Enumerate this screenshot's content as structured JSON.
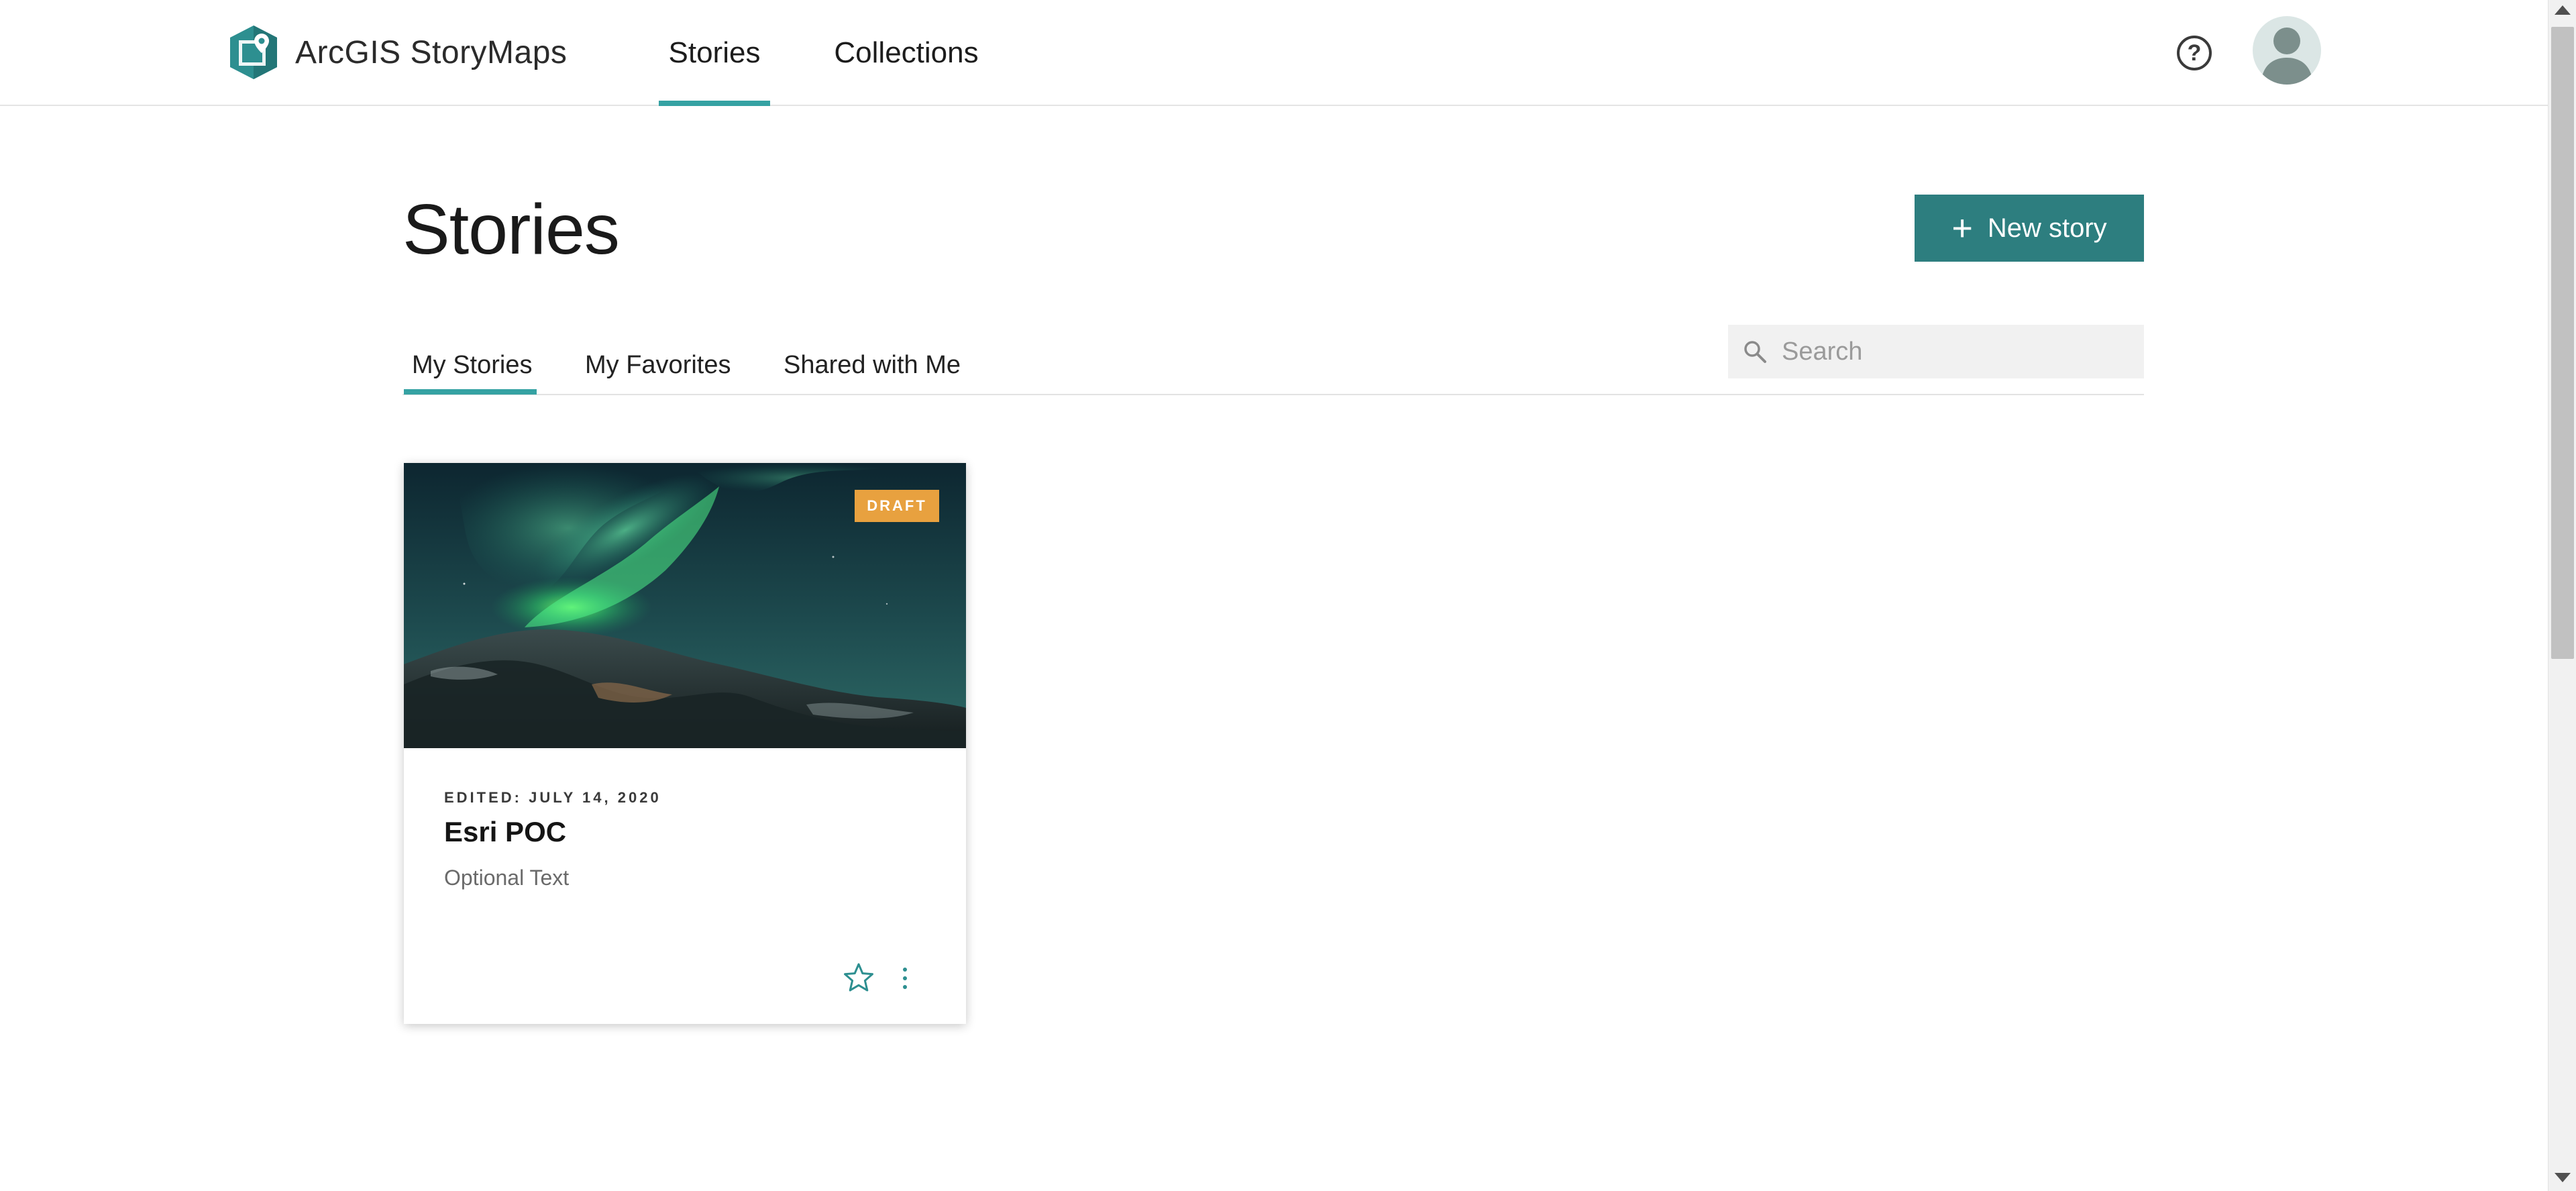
{
  "header": {
    "brand": "ArcGIS StoryMaps",
    "nav": {
      "stories": "Stories",
      "collections": "Collections"
    },
    "help_symbol": "?",
    "icons": {
      "logo": "storymaps-logo-icon",
      "help": "help-circle-icon",
      "avatar": "user-avatar-icon"
    }
  },
  "page": {
    "title": "Stories",
    "new_story_label": "New story",
    "new_story_symbol": "+"
  },
  "tabs": {
    "my_stories": "My Stories",
    "my_favorites": "My Favorites",
    "shared_with_me": "Shared with Me",
    "active": "My Stories"
  },
  "search": {
    "placeholder": "Search",
    "value": ""
  },
  "cards": [
    {
      "badge": "DRAFT",
      "meta": "EDITED: JULY 14, 2020",
      "title": "Esri POC",
      "description": "Optional Text",
      "favorited": false
    }
  ],
  "colors": {
    "accent": "#35a2a3",
    "button": "#2d7e7f",
    "draft_badge": "#e8a13f"
  }
}
